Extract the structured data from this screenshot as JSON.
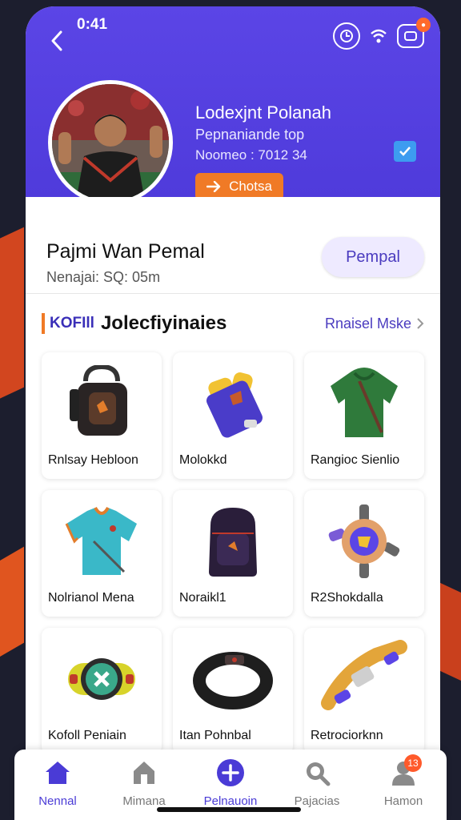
{
  "status": {
    "time": "0:41"
  },
  "profile": {
    "name": "Lodexjnt Polanah",
    "role": "Pepnaniande top",
    "number": "Noomeo : 7012 34",
    "choose_label": "Chotsa"
  },
  "info": {
    "title": "Pajmi Wan Pemal",
    "subtitle": "Nenajai: SQ: 05m",
    "button_label": "Pempal"
  },
  "section": {
    "tag": "KOFIll",
    "title": "Jolecfiyinaies",
    "see_more": "Rnaisel Mske"
  },
  "products": [
    {
      "label": "Rnlsay Hebloon",
      "icon": "sling-bag-icon"
    },
    {
      "label": "Molokkd",
      "icon": "phone-pouch-icon"
    },
    {
      "label": "Rangioc Sienlio",
      "icon": "hoodie-icon"
    },
    {
      "label": "Nolrianol Mena",
      "icon": "jersey-icon"
    },
    {
      "label": "Noraikl1",
      "icon": "backpack-icon"
    },
    {
      "label": "R2Shokdalla",
      "icon": "fidget-spinner-icon"
    },
    {
      "label": "Kofoll Peniain",
      "icon": "smartwatch-icon"
    },
    {
      "label": "Itan Pohnbal",
      "icon": "wristband-icon"
    },
    {
      "label": "Retrociorknn",
      "icon": "strap-watch-icon"
    }
  ],
  "nav": [
    {
      "label": "Nennal",
      "icon": "home-icon",
      "active": true
    },
    {
      "label": "Mimana",
      "icon": "store-icon",
      "active": false
    },
    {
      "label": "Pelnauoin",
      "icon": "add-icon",
      "active": true
    },
    {
      "label": "Pajacias",
      "icon": "search-icon",
      "active": false
    },
    {
      "label": "Hamon",
      "icon": "profile-icon",
      "active": false,
      "badge": "13"
    }
  ],
  "colors": {
    "accent": "#5b45e6",
    "orange": "#f07a26"
  }
}
